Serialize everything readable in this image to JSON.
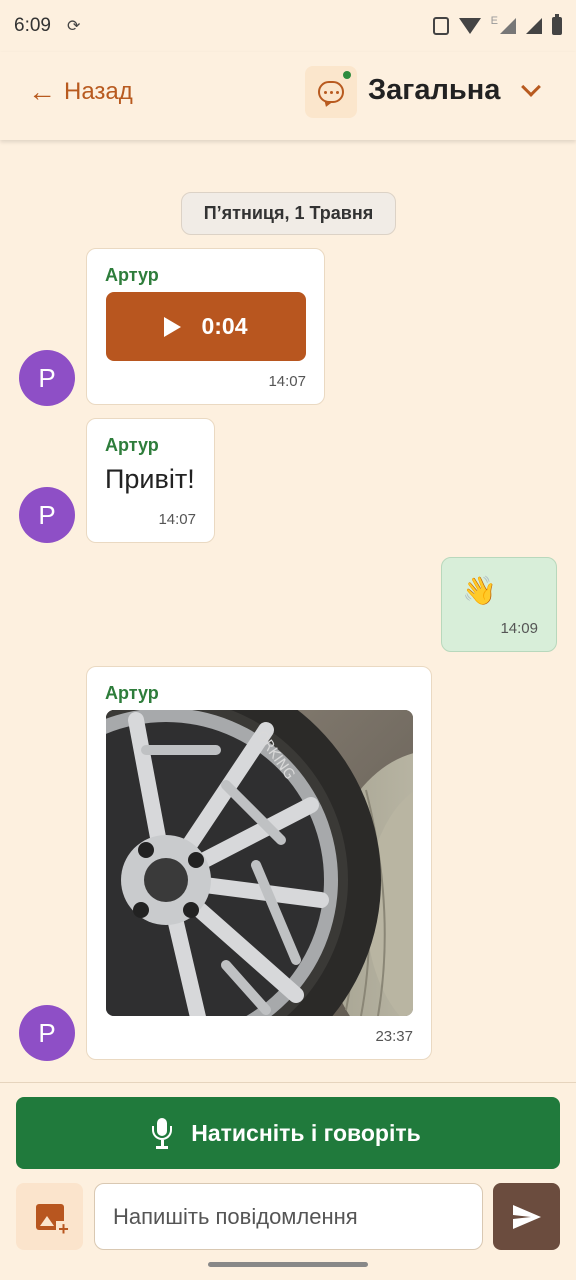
{
  "status_bar": {
    "time": "6:09",
    "network_badge": "E"
  },
  "header": {
    "back_label": "Назад",
    "room_title": "Загальна",
    "online_color": "#2e8b3d"
  },
  "date_separator": "П’ятниця, 1 Травня",
  "messages": [
    {
      "type": "audio",
      "sender": "Артур",
      "avatar_letter": "P",
      "duration": "0:04",
      "time": "14:07"
    },
    {
      "type": "text",
      "sender": "Артур",
      "avatar_letter": "P",
      "text": "Привіт!",
      "time": "14:07"
    },
    {
      "type": "own",
      "text": "👋",
      "time": "14:09"
    },
    {
      "type": "image",
      "sender": "Артур",
      "avatar_letter": "P",
      "tire_text": "ORKING",
      "time": "23:37"
    }
  ],
  "composer": {
    "talk_label": "Натисніть і говоріть",
    "input_placeholder": "Напишіть повідомлення"
  },
  "colors": {
    "accent": "#b8561f",
    "primary_green": "#207a3c",
    "sender_green": "#2e7d3b",
    "avatar_purple": "#8e4fc6",
    "background": "#fdf0df",
    "send_button": "#6b4c3e"
  }
}
